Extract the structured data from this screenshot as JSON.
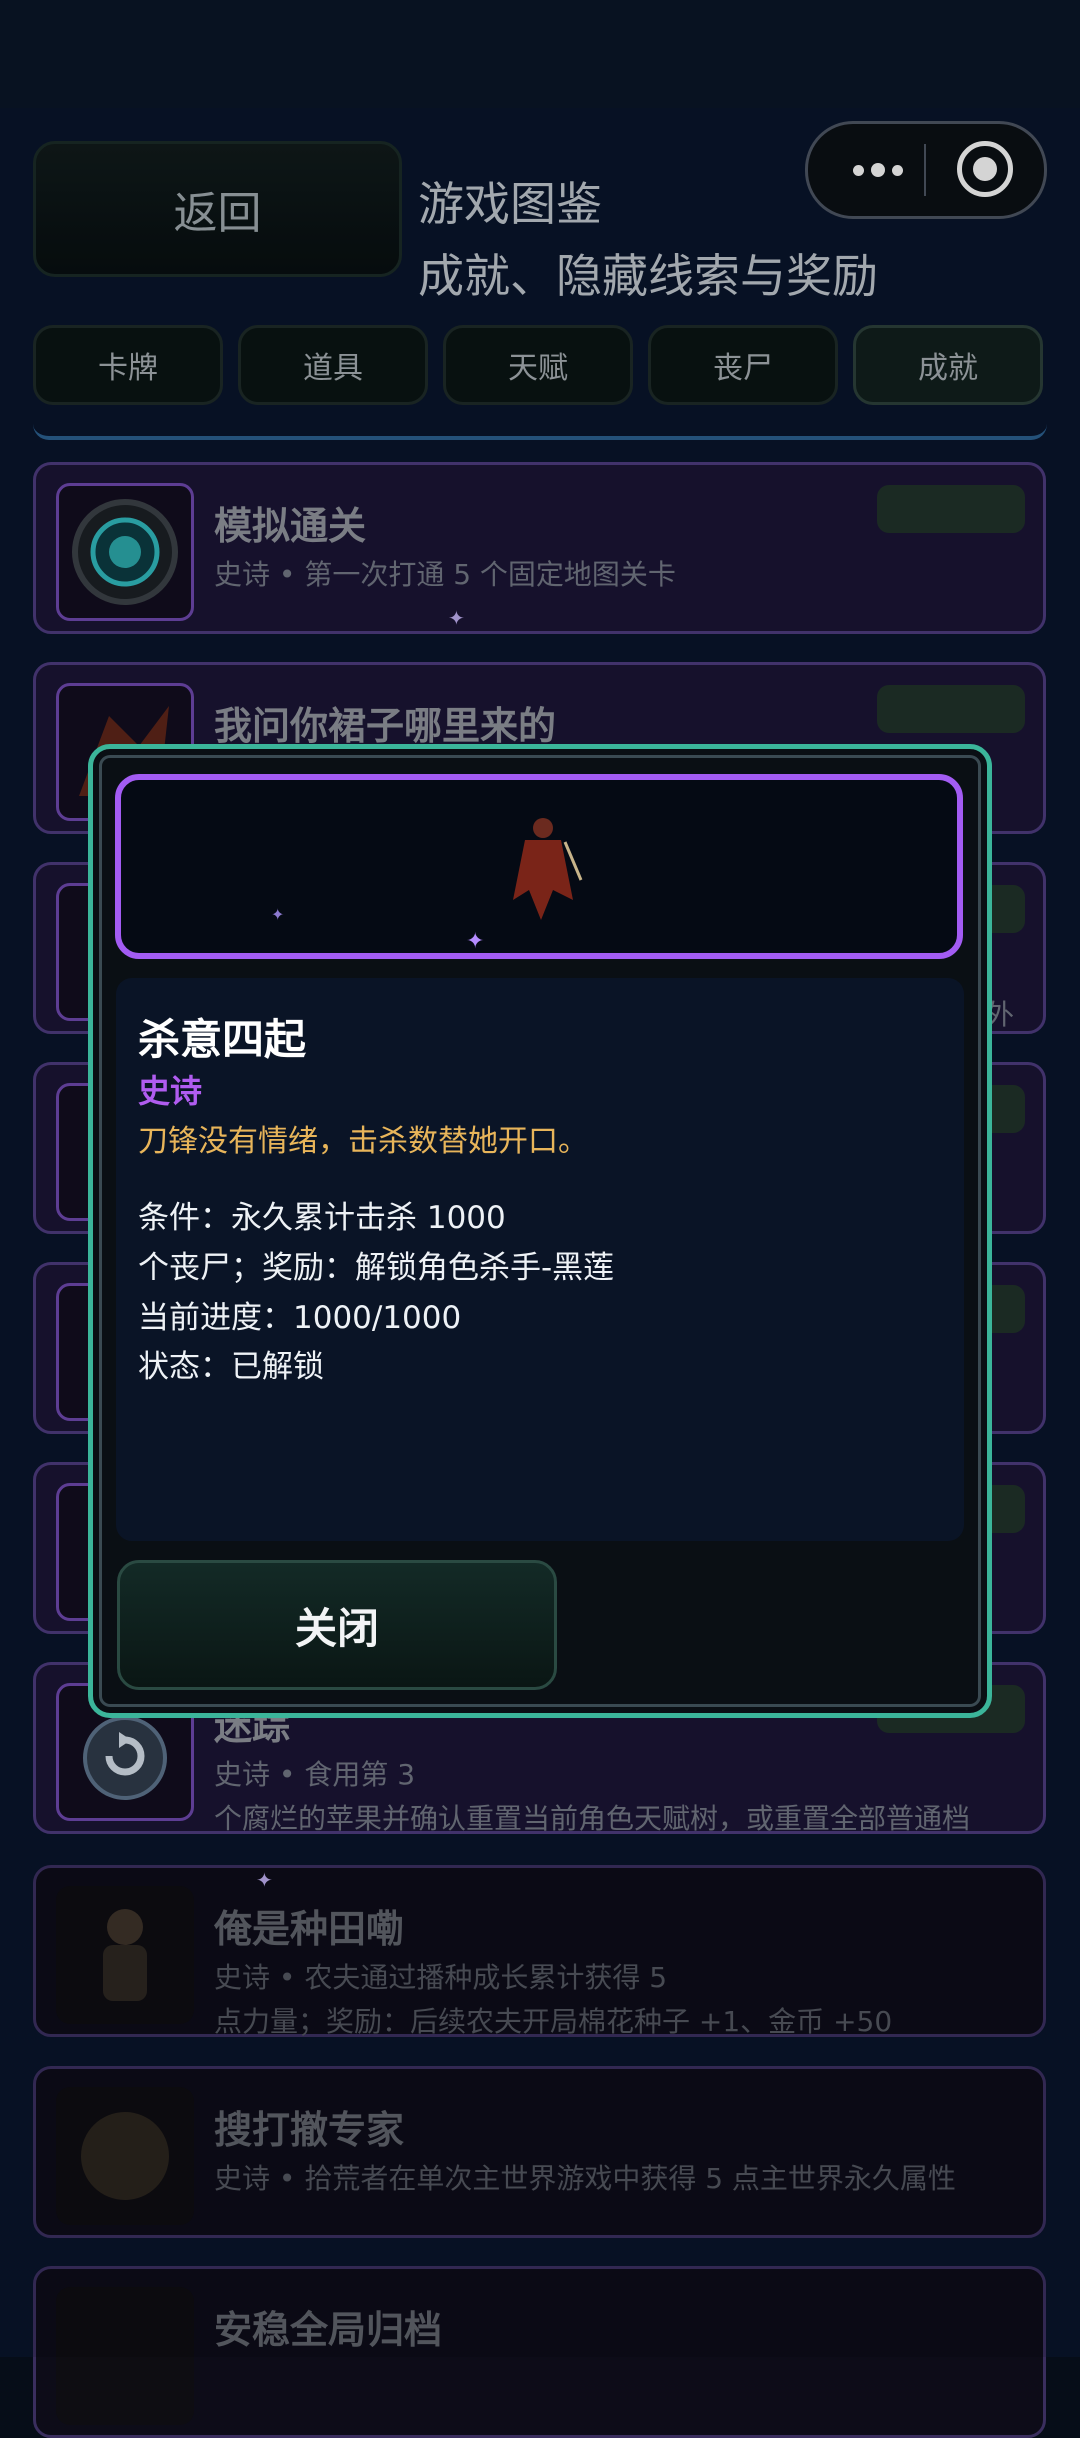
{
  "header": {
    "back_label": "返回",
    "title": "游戏图鉴",
    "subtitle": "成就、隐藏线索与奖励"
  },
  "tabs": [
    {
      "label": "卡牌",
      "active": false
    },
    {
      "label": "道具",
      "active": false
    },
    {
      "label": "天赋",
      "active": false
    },
    {
      "label": "丧尸",
      "active": false
    },
    {
      "label": "成就",
      "active": true
    }
  ],
  "cards": [
    {
      "name": "模拟通关",
      "desc": "史诗 • 第一次打通 5 个固定地图关卡",
      "desc2": ""
    },
    {
      "name": "我问你裙子哪里来的",
      "desc": "",
      "desc2": ""
    },
    {
      "name": "",
      "desc": "",
      "desc2": "外"
    },
    {
      "name": "",
      "desc": "",
      "desc2": ""
    },
    {
      "name": "",
      "desc": "",
      "desc2": ""
    },
    {
      "name": "",
      "desc": "",
      "desc2": ""
    },
    {
      "name": "迷踪",
      "desc": "史诗 • 食用第 3",
      "desc2": "个腐烂的苹果并确认重置当前角色天赋树，或重置全部普通档"
    },
    {
      "name": "俺是种田嘞",
      "desc": "史诗 • 农夫通过播种成长累计获得 5",
      "desc2": "点力量；奖励：后续农夫开局棉花种子 +1、金币 +50"
    },
    {
      "name": "搜打撤专家",
      "desc": "史诗 • 拾荒者在单次主世界游戏中获得 5 点主世界永久属性",
      "desc2": ""
    },
    {
      "name": "安稳全局归档",
      "desc": "",
      "desc2": ""
    }
  ],
  "modal": {
    "name": "杀意四起",
    "rarity": "史诗",
    "flavor": "刀锋没有情绪，击杀数替她开口。",
    "lines": [
      "条件：永久累计击杀 1000",
      "个丧尸；奖励：解锁角色杀手-黑莲",
      "当前进度：1000/1000",
      "状态：已解锁"
    ],
    "close_label": "关闭"
  },
  "colors": {
    "modal_border": "#3bb59a",
    "hero_border": "#a35cf3",
    "rarity": "#b05cf0",
    "flavor": "#e8b55a",
    "card_border": "#4b3a7a"
  }
}
